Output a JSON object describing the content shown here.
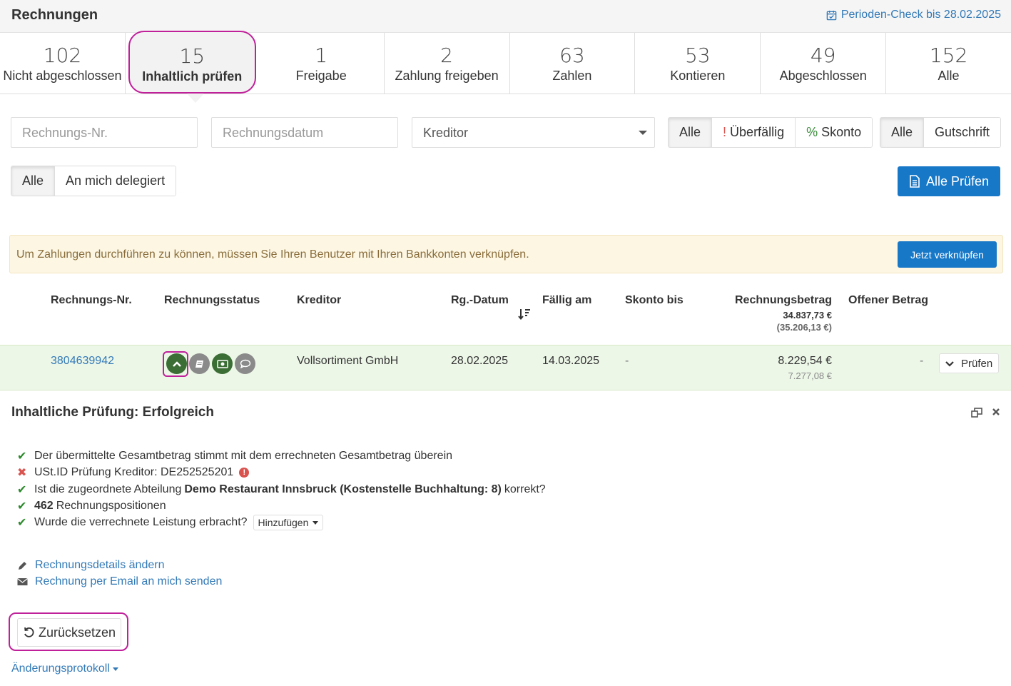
{
  "header": {
    "title": "Rechnungen",
    "period_check": "Perioden-Check bis 28.02.2025"
  },
  "stats": [
    {
      "count": "102",
      "label": "Nicht abgeschlossen"
    },
    {
      "count": "15",
      "label": "Inhaltlich prüfen"
    },
    {
      "count": "1",
      "label": "Freigabe"
    },
    {
      "count": "2",
      "label": "Zahlung freigeben"
    },
    {
      "count": "63",
      "label": "Zahlen"
    },
    {
      "count": "53",
      "label": "Kontieren"
    },
    {
      "count": "49",
      "label": "Abgeschlossen"
    },
    {
      "count": "152",
      "label": "Alle"
    }
  ],
  "filters": {
    "invoice_no_placeholder": "Rechnungs-Nr.",
    "invoice_date_placeholder": "Rechnungsdatum",
    "creditor_select": "Kreditor",
    "due_all": "Alle",
    "overdue_mark": "!",
    "overdue": "Überfällig",
    "discount_mark": "%",
    "discount": "Skonto",
    "type_all": "Alle",
    "credit_note": "Gutschrift",
    "assign_all": "Alle",
    "delegated": "An mich delegiert",
    "check_all": "Alle Prüfen"
  },
  "alert": {
    "message": "Um Zahlungen durchführen zu können, müssen Sie Ihren Benutzer mit Ihren Bankkonten verknüpfen.",
    "action": "Jetzt verknüpfen"
  },
  "table": {
    "headers": {
      "invoice_no": "Rechnungs-Nr.",
      "status": "Rechnungsstatus",
      "creditor": "Kreditor",
      "date": "Rg.-Datum",
      "due": "Fällig am",
      "discount_until": "Skonto bis",
      "amount": "Rechnungsbetrag",
      "amount_total": "34.837,73 €",
      "amount_total_gross": "(35.206,13 €)",
      "open_amount": "Offener Betrag"
    },
    "rows": [
      {
        "invoice_no": "3804639942",
        "creditor": "Vollsortiment GmbH",
        "date": "28.02.2025",
        "due": "14.03.2025",
        "discount_until": "-",
        "amount": "8.229,54 €",
        "amount_net": "7.277,08 €",
        "open_amount": "-",
        "action": "Prüfen"
      }
    ]
  },
  "detail": {
    "title": "Inhaltliche Prüfung: Erfolgreich",
    "checks": {
      "c1": "Der übermittelte Gesamtbetrag stimmt mit dem errechneten Gesamtbetrag überein",
      "c2": "USt.ID Prüfung Kreditor: DE252525201",
      "c3_pre": "Ist die zugeordnete Abteilung",
      "c3_bold": "Demo Restaurant Innsbruck (Kostenstelle Buchhaltung: 8)",
      "c3_post": "korrekt?",
      "c4_bold": "462",
      "c4_post": "Rechnungspositionen",
      "c5": "Wurde die verrechnete Leistung erbracht?",
      "c5_dropdown": "Hinzufügen"
    },
    "links": {
      "edit": "Rechnungsdetails ändern",
      "email": "Rechnung per Email an mich senden"
    },
    "reset": "Zurücksetzen",
    "changelog": "Änderungsprotokoll"
  }
}
